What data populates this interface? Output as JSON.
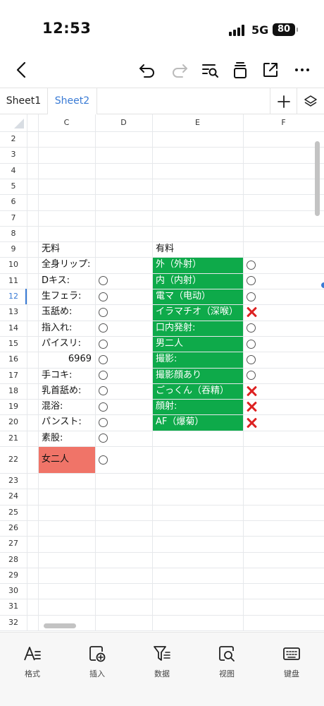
{
  "status_bar": {
    "time": "12:53",
    "network": "5G",
    "battery": "80"
  },
  "toolbar": {
    "back_icon": "chevron-left-icon",
    "undo_icon": "undo-icon",
    "redo_icon": "redo-icon",
    "find_icon": "find-replace-icon",
    "clear_icon": "clipboard-icon",
    "share_icon": "share-icon",
    "more_icon": "more-icon"
  },
  "sheet_tabs": [
    {
      "label": "Sheet1",
      "active": false
    },
    {
      "label": "Sheet2",
      "active": true
    }
  ],
  "columns": [
    "C",
    "D",
    "E",
    "F"
  ],
  "rows": [
    "2",
    "3",
    "4",
    "5",
    "6",
    "7",
    "8",
    "9",
    "10",
    "11",
    "12",
    "13",
    "14",
    "15",
    "16",
    "17",
    "18",
    "19",
    "20",
    "21",
    "22",
    "23",
    "24",
    "25",
    "26",
    "27",
    "28",
    "29",
    "30",
    "31",
    "32"
  ],
  "cells": {
    "c9": "无料",
    "e9": "有料",
    "c_list": [
      "全身リップ:",
      "Dキス:",
      "生フェラ:",
      "玉舐め:",
      "指入れ:",
      "パイスリ:",
      "6969",
      "手コキ:",
      "乳首舐め:",
      "混浴:",
      "パンスト:",
      "素股:"
    ],
    "c22": "女二人",
    "e_list": [
      "外（外射）",
      "内（内射）",
      "電マ（电动）",
      "イラマチオ（深喉）",
      "口内発射:",
      "男二人",
      "撮影:",
      "撮影顔あり",
      "ごっくん（吞精）",
      "顔射:",
      "AF（爆菊）"
    ],
    "f_marks": [
      "circle",
      "circle",
      "circle",
      "cross",
      "circle",
      "circle",
      "circle",
      "circle",
      "cross",
      "cross",
      "cross"
    ]
  },
  "colors": {
    "green_fill": "#0eaa4a",
    "red_fill": "#f07468",
    "accent": "#3a7bd5",
    "cross": "#dd2222"
  },
  "bottom_bar": [
    {
      "label": "格式",
      "icon": "format-icon"
    },
    {
      "label": "插入",
      "icon": "insert-icon"
    },
    {
      "label": "数据",
      "icon": "data-filter-icon"
    },
    {
      "label": "视图",
      "icon": "view-icon"
    },
    {
      "label": "键盘",
      "icon": "keyboard-icon"
    }
  ]
}
